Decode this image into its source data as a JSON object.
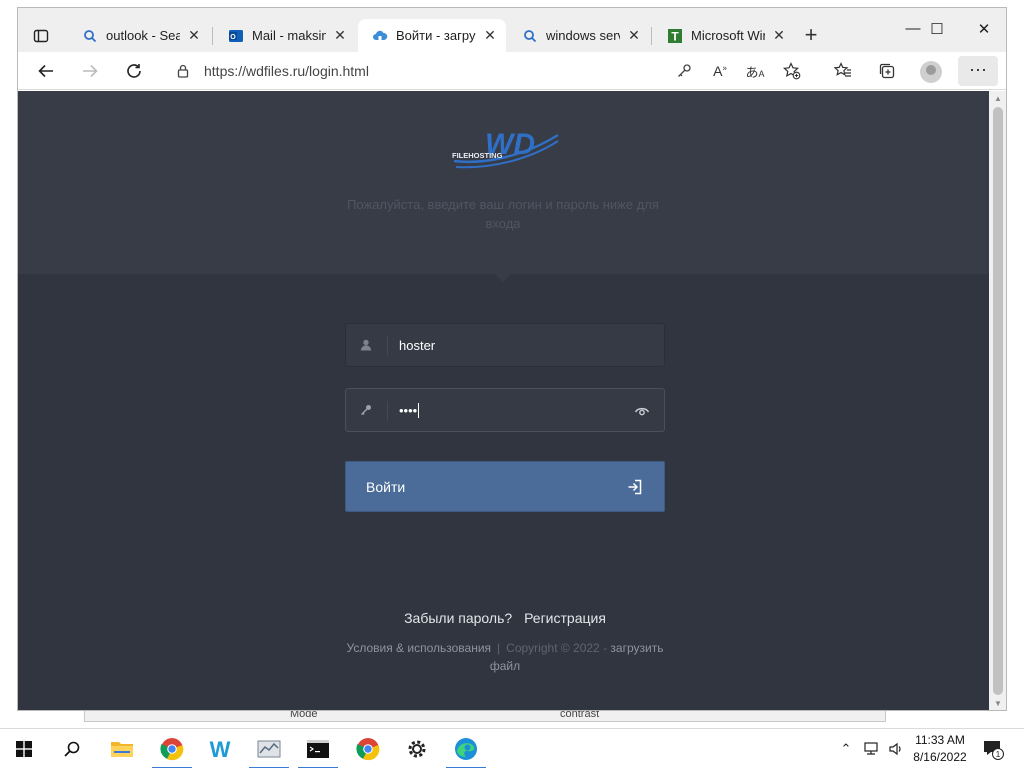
{
  "tabs": [
    {
      "title": "outlook - Search",
      "favicon": "search-icon",
      "active": false
    },
    {
      "title": "Mail - maksim",
      "favicon": "outlook-icon",
      "active": false
    },
    {
      "title": "Войти - загрузить",
      "favicon": "cloud-icon",
      "active": true
    },
    {
      "title": "windows server",
      "favicon": "search-icon",
      "active": false
    },
    {
      "title": "Microsoft Windows",
      "favicon": "t-icon",
      "active": false
    }
  ],
  "address_bar": {
    "url": "https://wdfiles.ru/login.html"
  },
  "page": {
    "logo": {
      "text": "WD",
      "subtext": "FILEHOSTING"
    },
    "subtitle": "Пожалуйста, введите ваш логин и пароль ниже для входа",
    "username_value": "hoster",
    "password_masked": "••••",
    "login_button": "Войти",
    "forgot_link": "Забыли пароль?",
    "register_link": "Регистрация",
    "terms_link": "Условия & использования",
    "footer_separator": "|",
    "copyright": "Copyright © 2022 -",
    "site_link": "загрузить файл"
  },
  "background_window": {
    "label_left": "Mode",
    "label_right": "contrast"
  },
  "taskbar": {
    "time": "11:33 AM",
    "date": "8/16/2022",
    "notification_count": "1"
  },
  "colors": {
    "page_bg": "#30353f",
    "hero_bg": "#373c46",
    "button_bg": "#4b6c98",
    "logo_blue": "#2f6fc6"
  }
}
